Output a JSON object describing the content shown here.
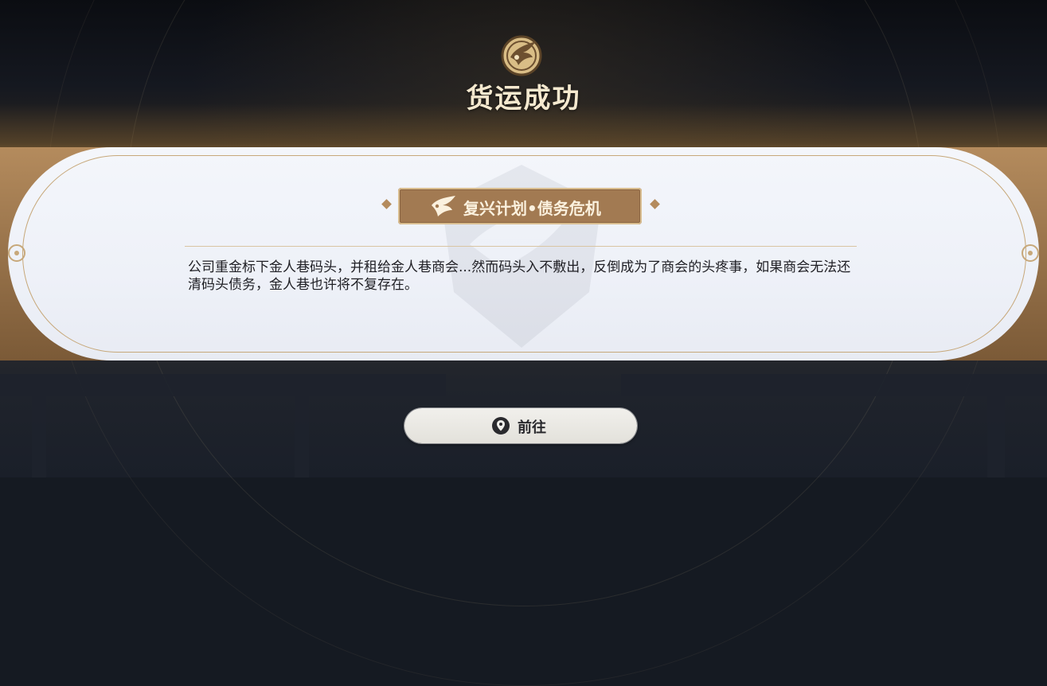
{
  "dialog": {
    "title": "货运成功",
    "tag": "复兴计划•债务危机",
    "description": "公司重金标下金人巷码头，并租给金人巷商会...然而码头入不敷出，反倒成为了商会的头疼事，如果商会无法还清码头债务，金人巷也许将不复存在。"
  },
  "actions": {
    "go_label": "前往"
  },
  "icons": {
    "emblem": "phoenix-emblem-icon",
    "tag": "phoenix-icon",
    "go": "location-pin-icon"
  },
  "colors": {
    "title": "#f5e9cf",
    "tag_bg": "#a27a52",
    "card_bg": "#eef1f8",
    "gold": "#c7a87a"
  }
}
